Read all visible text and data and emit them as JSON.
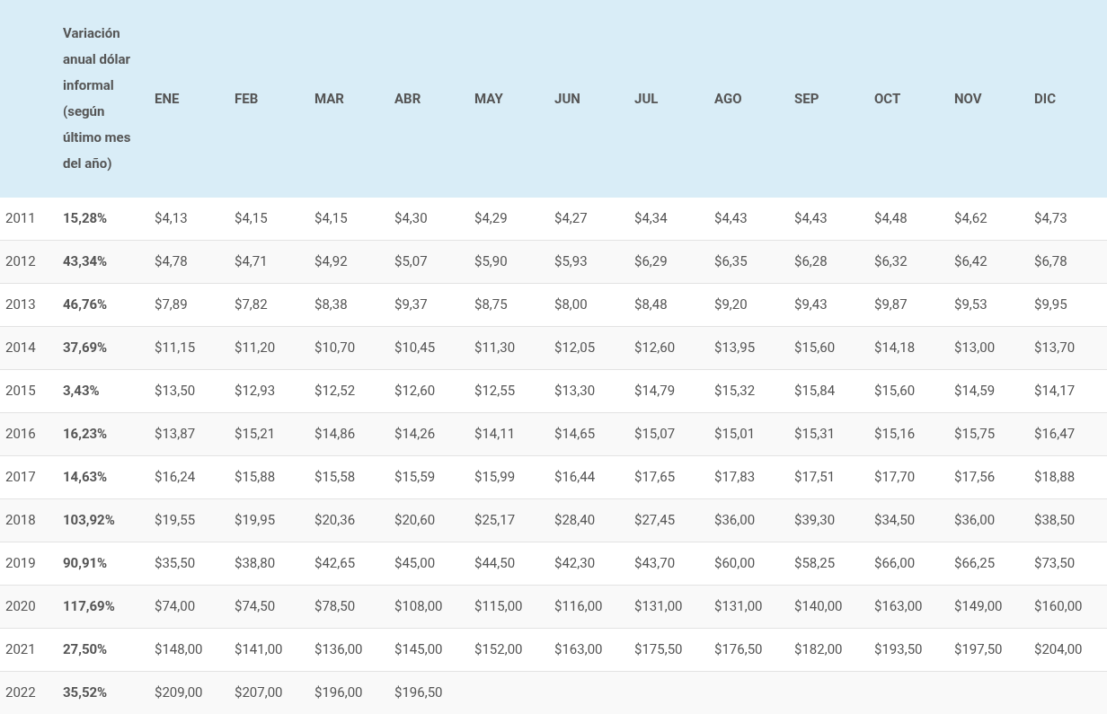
{
  "table": {
    "columns": [
      "",
      "Variación anual dólar informal (según último mes del año)",
      "ENE",
      "FEB",
      "MAR",
      "ABR",
      "MAY",
      "JUN",
      "JUL",
      "AGO",
      "SEP",
      "OCT",
      "NOV",
      "DIC"
    ],
    "rows": [
      {
        "year": "2011",
        "variation": "15,28%",
        "values": [
          "$4,13",
          "$4,15",
          "$4,15",
          "$4,30",
          "$4,29",
          "$4,27",
          "$4,34",
          "$4,43",
          "$4,43",
          "$4,48",
          "$4,62",
          "$4,73"
        ]
      },
      {
        "year": "2012",
        "variation": "43,34%",
        "values": [
          "$4,78",
          "$4,71",
          "$4,92",
          "$5,07",
          "$5,90",
          "$5,93",
          "$6,29",
          "$6,35",
          "$6,28",
          "$6,32",
          "$6,42",
          "$6,78"
        ]
      },
      {
        "year": "2013",
        "variation": "46,76%",
        "values": [
          "$7,89",
          "$7,82",
          "$8,38",
          "$9,37",
          "$8,75",
          "$8,00",
          "$8,48",
          "$9,20",
          "$9,43",
          "$9,87",
          "$9,53",
          "$9,95"
        ]
      },
      {
        "year": "2014",
        "variation": "37,69%",
        "values": [
          "$11,15",
          "$11,20",
          "$10,70",
          "$10,45",
          "$11,30",
          "$12,05",
          "$12,60",
          "$13,95",
          "$15,60",
          "$14,18",
          "$13,00",
          "$13,70"
        ]
      },
      {
        "year": "2015",
        "variation": "3,43%",
        "values": [
          "$13,50",
          "$12,93",
          "$12,52",
          "$12,60",
          "$12,55",
          "$13,30",
          "$14,79",
          "$15,32",
          "$15,84",
          "$15,60",
          "$14,59",
          "$14,17"
        ]
      },
      {
        "year": "2016",
        "variation": "16,23%",
        "values": [
          "$13,87",
          "$15,21",
          "$14,86",
          "$14,26",
          "$14,11",
          "$14,65",
          "$15,07",
          "$15,01",
          "$15,31",
          "$15,16",
          "$15,75",
          "$16,47"
        ]
      },
      {
        "year": "2017",
        "variation": "14,63%",
        "values": [
          "$16,24",
          "$15,88",
          "$15,58",
          "$15,59",
          "$15,99",
          "$16,44",
          "$17,65",
          "$17,83",
          "$17,51",
          "$17,70",
          "$17,56",
          "$18,88"
        ]
      },
      {
        "year": "2018",
        "variation": "103,92%",
        "values": [
          "$19,55",
          "$19,95",
          "$20,36",
          "$20,60",
          "$25,17",
          "$28,40",
          "$27,45",
          "$36,00",
          "$39,30",
          "$34,50",
          "$36,00",
          "$38,50"
        ]
      },
      {
        "year": "2019",
        "variation": "90,91%",
        "values": [
          "$35,50",
          "$38,80",
          "$42,65",
          "$45,00",
          "$44,50",
          "$42,30",
          "$43,70",
          "$60,00",
          "$58,25",
          "$66,00",
          "$66,25",
          "$73,50"
        ]
      },
      {
        "year": "2020",
        "variation": "117,69%",
        "values": [
          "$74,00",
          "$74,50",
          "$78,50",
          "$108,00",
          "$115,00",
          "$116,00",
          "$131,00",
          "$131,00",
          "$140,00",
          "$163,00",
          "$149,00",
          "$160,00"
        ]
      },
      {
        "year": "2021",
        "variation": "27,50%",
        "values": [
          "$148,00",
          "$141,00",
          "$136,00",
          "$145,00",
          "$152,00",
          "$163,00",
          "$175,50",
          "$176,50",
          "$182,00",
          "$193,50",
          "$197,50",
          "$204,00"
        ]
      },
      {
        "year": "2022",
        "variation": "35,52%",
        "values": [
          "$209,00",
          "$207,00",
          "$196,00",
          "$196,50"
        ]
      }
    ]
  }
}
